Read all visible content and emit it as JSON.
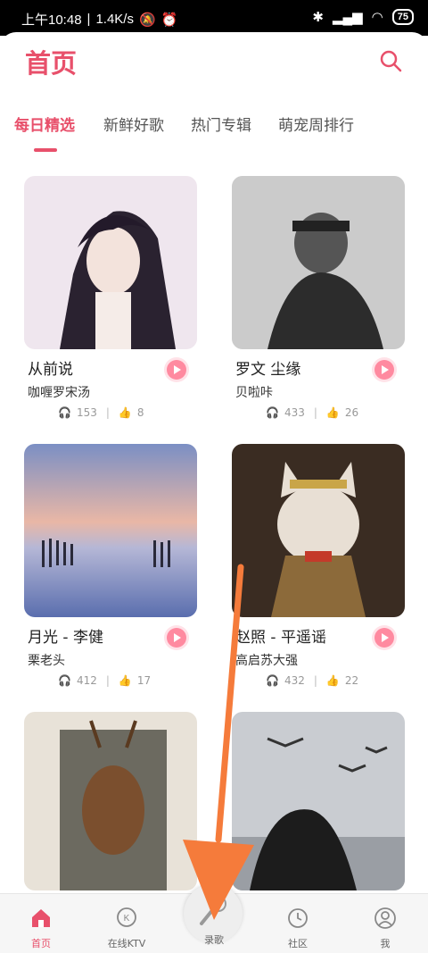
{
  "statusbar": {
    "time": "上午10:48",
    "speed": "1.4K/s",
    "battery": "75"
  },
  "header": {
    "title": "首页"
  },
  "tabs": [
    {
      "label": "每日精选"
    },
    {
      "label": "新鲜好歌"
    },
    {
      "label": "热门专辑"
    },
    {
      "label": "萌宠周排行"
    }
  ],
  "songs": [
    {
      "title": "从前说",
      "artist": "咖喱罗宋汤",
      "plays": "153",
      "likes": "8"
    },
    {
      "title": "罗文 尘缘",
      "artist": "贝啦咔",
      "plays": "433",
      "likes": "26"
    },
    {
      "title": "月光 - 李健",
      "artist": "栗老头",
      "plays": "412",
      "likes": "17"
    },
    {
      "title": "赵照 - 平遥谣",
      "artist": "高启苏大强",
      "plays": "432",
      "likes": "22"
    }
  ],
  "bottom_nav": [
    {
      "label": "首页",
      "icon": "home-icon"
    },
    {
      "label": "在线KTV",
      "icon": "ktv-icon"
    },
    {
      "label": "录歌",
      "icon": "microphone-icon"
    },
    {
      "label": "社区",
      "icon": "clock-icon"
    },
    {
      "label": "我",
      "icon": "user-icon"
    }
  ],
  "colors": {
    "accent": "#e8506b",
    "arrow": "#f57b3b"
  }
}
